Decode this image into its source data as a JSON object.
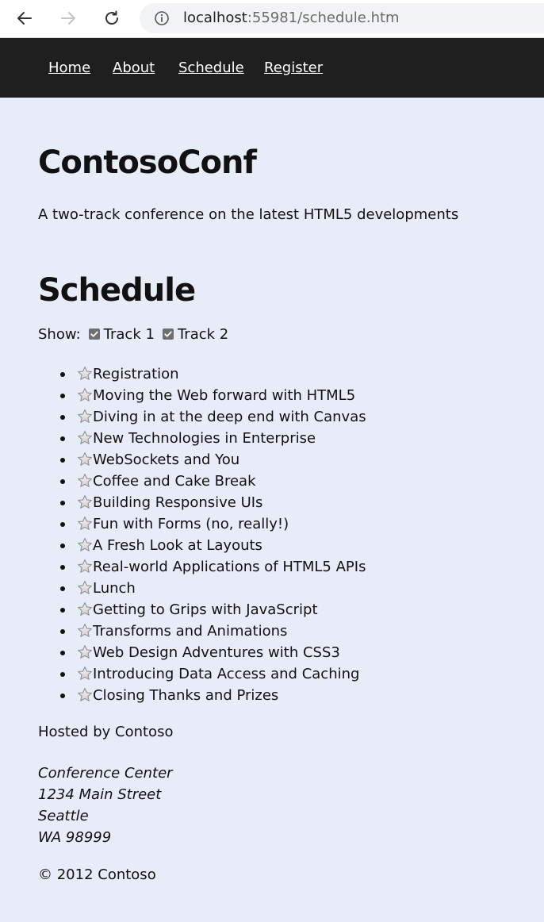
{
  "browser": {
    "url_host": "localhost",
    "url_rest": ":55981/schedule.htm"
  },
  "nav": {
    "items": [
      {
        "label": "Home"
      },
      {
        "label": "About"
      },
      {
        "label": "Schedule"
      },
      {
        "label": "Register"
      }
    ]
  },
  "header": {
    "title": "ContosoConf",
    "tagline": "A two-track conference on the latest HTML5 developments"
  },
  "schedule": {
    "heading": "Schedule",
    "show_label": "Show:",
    "tracks": [
      {
        "label": "Track 1",
        "checked": true
      },
      {
        "label": "Track 2",
        "checked": true
      }
    ],
    "sessions": [
      "Registration",
      "Moving the Web forward with HTML5",
      "Diving in at the deep end with Canvas",
      "New Technologies in Enterprise",
      "WebSockets and You",
      "Coffee and Cake Break",
      "Building Responsive UIs",
      "Fun with Forms (no, really!)",
      "A Fresh Look at Layouts",
      "Real-world Applications of HTML5 APIs",
      "Lunch",
      "Getting to Grips with JavaScript",
      "Transforms and Animations",
      "Web Design Adventures with CSS3",
      "Introducing Data Access and Caching",
      "Closing Thanks and Prizes"
    ]
  },
  "footer": {
    "hosted": "Hosted by Contoso",
    "address": [
      "Conference Center",
      "1234 Main Street",
      "Seattle",
      "WA 98999"
    ],
    "copyright": "© 2012 Contoso"
  },
  "colors": {
    "page_bg": "#e8ecf8",
    "nav_bg": "#1f1f1f",
    "text": "#111111"
  },
  "icons": {
    "star": "star-icon",
    "bullet": "bullet-icon"
  }
}
